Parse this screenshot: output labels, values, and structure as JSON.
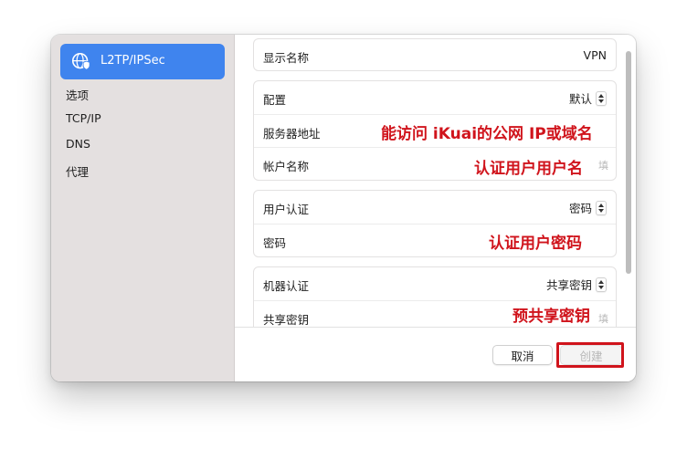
{
  "sidebar": {
    "selected": {
      "label": "L2TP/IPSec",
      "icon": "globe-shield-icon"
    },
    "items": [
      {
        "label": "选项"
      },
      {
        "label": "TCP/IP"
      },
      {
        "label": "DNS"
      },
      {
        "label": "代理"
      }
    ]
  },
  "form": {
    "display_name": {
      "label": "显示名称",
      "value": "VPN"
    },
    "config": {
      "label": "配置",
      "value": "默认"
    },
    "server_address": {
      "label": "服务器地址"
    },
    "account_name": {
      "label": "帐户名称",
      "placeholder_hint": "填"
    },
    "user_auth": {
      "label": "用户认证",
      "value": "密码"
    },
    "password": {
      "label": "密码"
    },
    "machine_auth": {
      "label": "机器认证",
      "value": "共享密钥"
    },
    "shared_secret": {
      "label": "共享密钥",
      "placeholder_hint": "填"
    }
  },
  "annotations": {
    "server": "能访问 iKuai的公网 IP或域名",
    "account": "认证用户用户名",
    "password": "认证用户密码",
    "secret": "预共享密钥"
  },
  "footer": {
    "cancel_label": "取消",
    "create_label": "创建"
  },
  "colors": {
    "accent": "#3f84ee",
    "annotation": "#d0141c",
    "sidebar_bg": "#e4e0e0"
  }
}
